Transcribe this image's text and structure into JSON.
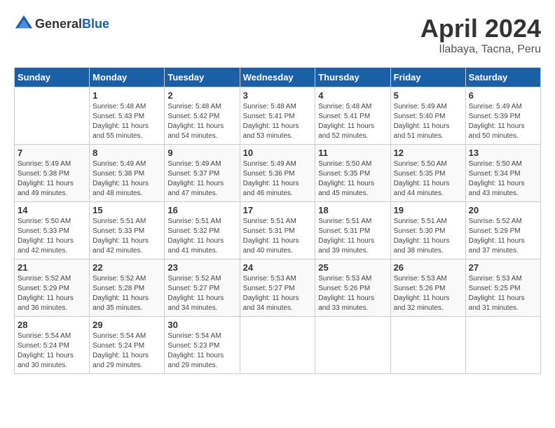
{
  "header": {
    "logo": {
      "text_general": "General",
      "text_blue": "Blue"
    },
    "title": "April 2024",
    "subtitle": "Ilabaya, Tacna, Peru"
  },
  "calendar": {
    "days_of_week": [
      "Sunday",
      "Monday",
      "Tuesday",
      "Wednesday",
      "Thursday",
      "Friday",
      "Saturday"
    ],
    "weeks": [
      [
        {
          "day": "",
          "info": ""
        },
        {
          "day": "1",
          "info": "Sunrise: 5:48 AM\nSunset: 5:43 PM\nDaylight: 11 hours\nand 55 minutes."
        },
        {
          "day": "2",
          "info": "Sunrise: 5:48 AM\nSunset: 5:42 PM\nDaylight: 11 hours\nand 54 minutes."
        },
        {
          "day": "3",
          "info": "Sunrise: 5:48 AM\nSunset: 5:41 PM\nDaylight: 11 hours\nand 53 minutes."
        },
        {
          "day": "4",
          "info": "Sunrise: 5:48 AM\nSunset: 5:41 PM\nDaylight: 11 hours\nand 52 minutes."
        },
        {
          "day": "5",
          "info": "Sunrise: 5:49 AM\nSunset: 5:40 PM\nDaylight: 11 hours\nand 51 minutes."
        },
        {
          "day": "6",
          "info": "Sunrise: 5:49 AM\nSunset: 5:39 PM\nDaylight: 11 hours\nand 50 minutes."
        }
      ],
      [
        {
          "day": "7",
          "info": "Sunrise: 5:49 AM\nSunset: 5:38 PM\nDaylight: 11 hours\nand 49 minutes."
        },
        {
          "day": "8",
          "info": "Sunrise: 5:49 AM\nSunset: 5:38 PM\nDaylight: 11 hours\nand 48 minutes."
        },
        {
          "day": "9",
          "info": "Sunrise: 5:49 AM\nSunset: 5:37 PM\nDaylight: 11 hours\nand 47 minutes."
        },
        {
          "day": "10",
          "info": "Sunrise: 5:49 AM\nSunset: 5:36 PM\nDaylight: 11 hours\nand 46 minutes."
        },
        {
          "day": "11",
          "info": "Sunrise: 5:50 AM\nSunset: 5:35 PM\nDaylight: 11 hours\nand 45 minutes."
        },
        {
          "day": "12",
          "info": "Sunrise: 5:50 AM\nSunset: 5:35 PM\nDaylight: 11 hours\nand 44 minutes."
        },
        {
          "day": "13",
          "info": "Sunrise: 5:50 AM\nSunset: 5:34 PM\nDaylight: 11 hours\nand 43 minutes."
        }
      ],
      [
        {
          "day": "14",
          "info": "Sunrise: 5:50 AM\nSunset: 5:33 PM\nDaylight: 11 hours\nand 42 minutes."
        },
        {
          "day": "15",
          "info": "Sunrise: 5:51 AM\nSunset: 5:33 PM\nDaylight: 11 hours\nand 42 minutes."
        },
        {
          "day": "16",
          "info": "Sunrise: 5:51 AM\nSunset: 5:32 PM\nDaylight: 11 hours\nand 41 minutes."
        },
        {
          "day": "17",
          "info": "Sunrise: 5:51 AM\nSunset: 5:31 PM\nDaylight: 11 hours\nand 40 minutes."
        },
        {
          "day": "18",
          "info": "Sunrise: 5:51 AM\nSunset: 5:31 PM\nDaylight: 11 hours\nand 39 minutes."
        },
        {
          "day": "19",
          "info": "Sunrise: 5:51 AM\nSunset: 5:30 PM\nDaylight: 11 hours\nand 38 minutes."
        },
        {
          "day": "20",
          "info": "Sunrise: 5:52 AM\nSunset: 5:29 PM\nDaylight: 11 hours\nand 37 minutes."
        }
      ],
      [
        {
          "day": "21",
          "info": "Sunrise: 5:52 AM\nSunset: 5:29 PM\nDaylight: 11 hours\nand 36 minutes."
        },
        {
          "day": "22",
          "info": "Sunrise: 5:52 AM\nSunset: 5:28 PM\nDaylight: 11 hours\nand 35 minutes."
        },
        {
          "day": "23",
          "info": "Sunrise: 5:52 AM\nSunset: 5:27 PM\nDaylight: 11 hours\nand 34 minutes."
        },
        {
          "day": "24",
          "info": "Sunrise: 5:53 AM\nSunset: 5:27 PM\nDaylight: 11 hours\nand 34 minutes."
        },
        {
          "day": "25",
          "info": "Sunrise: 5:53 AM\nSunset: 5:26 PM\nDaylight: 11 hours\nand 33 minutes."
        },
        {
          "day": "26",
          "info": "Sunrise: 5:53 AM\nSunset: 5:26 PM\nDaylight: 11 hours\nand 32 minutes."
        },
        {
          "day": "27",
          "info": "Sunrise: 5:53 AM\nSunset: 5:25 PM\nDaylight: 11 hours\nand 31 minutes."
        }
      ],
      [
        {
          "day": "28",
          "info": "Sunrise: 5:54 AM\nSunset: 5:24 PM\nDaylight: 11 hours\nand 30 minutes."
        },
        {
          "day": "29",
          "info": "Sunrise: 5:54 AM\nSunset: 5:24 PM\nDaylight: 11 hours\nand 29 minutes."
        },
        {
          "day": "30",
          "info": "Sunrise: 5:54 AM\nSunset: 5:23 PM\nDaylight: 11 hours\nand 29 minutes."
        },
        {
          "day": "",
          "info": ""
        },
        {
          "day": "",
          "info": ""
        },
        {
          "day": "",
          "info": ""
        },
        {
          "day": "",
          "info": ""
        }
      ]
    ]
  }
}
